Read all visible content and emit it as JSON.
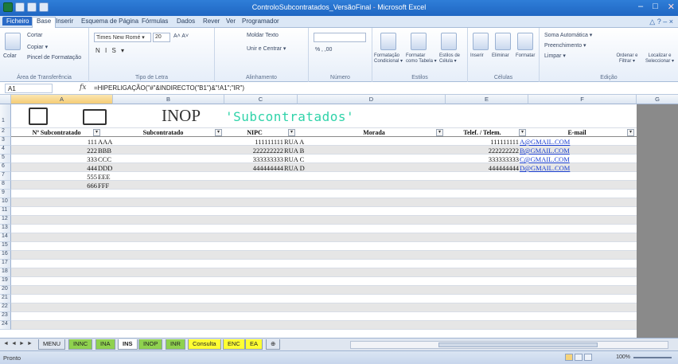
{
  "window": {
    "title_file": "ControloSubcontratados_VersãoFinal",
    "title_sep": " - ",
    "title_app": "Microsoft Excel",
    "min_glyph": "–",
    "max_glyph": "□",
    "close_glyph": "✕"
  },
  "menu": {
    "tabs": [
      "Ficheiro",
      "Base",
      "Inserir",
      "Esquema de Página",
      "Fórmulas",
      "Dados",
      "Rever",
      "Ver",
      "Programador"
    ],
    "help_glyph": "△ ? – ×"
  },
  "ribbon": {
    "clipboard": {
      "cut": "Cortar",
      "copy": "Copiar ▾",
      "paste": "Colar",
      "painter": "Pincel de Formatação",
      "label": "Área de Transferência"
    },
    "font": {
      "name": "Times New Romé ▾",
      "size": "20",
      "grow": "A˄ A˅",
      "bold_italic": "N  I  S ▾",
      "label": "Tipo de Letra"
    },
    "alignment": {
      "wrap": "Moldar Texto",
      "merge": "Unir e Centrar ▾",
      "label": "Alinhamento"
    },
    "number": {
      "format": "",
      "percent": "% ‚ ,00",
      "label": "Número"
    },
    "styles": {
      "cond": "Formatação Condicional ▾",
      "table": "Formatar como Tabela ▾",
      "cell": "Estilos de Célula ▾",
      "label": "Estilos"
    },
    "cells": {
      "insert": "Inserir",
      "delete": "Eliminar",
      "format": "Formatar",
      "label": "Células"
    },
    "editing": {
      "autosum": "Soma Automática ▾",
      "fill": "Preenchimento ▾",
      "clear": "Limpar ▾",
      "sort": "Ordenar e Filtrar ▾",
      "find": "Localizar e Seleccionar ▾",
      "label": "Edição"
    }
  },
  "formula_bar": {
    "name_box": "A1",
    "fx": "fx",
    "formula": "=HIPERLIGAÇÃO(\"#\"&INDIRECTO(\"B1\")&\"!A1\";\"IR\")"
  },
  "columns": [
    "A",
    "B",
    "C",
    "D",
    "E",
    "F",
    "G"
  ],
  "row_numbers": [
    "1",
    "2",
    "3",
    "4",
    "5",
    "6",
    "7",
    "8",
    "9",
    "10",
    "11",
    "12",
    "13",
    "14",
    "15",
    "16",
    "17",
    "18",
    "19",
    "20",
    "21",
    "22",
    "23",
    "24"
  ],
  "banner": {
    "inop": "INOP",
    "subtitle": "'Subcontratados'"
  },
  "table": {
    "headers": [
      "Nº Subcontratado",
      "Subcontratado",
      "NIPC",
      "Morada",
      "Telef. / Telem.",
      "E-mail"
    ],
    "rows": [
      {
        "num": "111",
        "name": "AAA",
        "nipc": "111111111",
        "morada": "RUA A",
        "tel": "111111111",
        "email": "A@GMAIL.COM"
      },
      {
        "num": "222",
        "name": "BBB",
        "nipc": "222222222",
        "morada": "RUA B",
        "tel": "222222222",
        "email": "B@GMAIL.COM"
      },
      {
        "num": "333",
        "name": "CCC",
        "nipc": "333333333",
        "morada": "RUA C",
        "tel": "333333333",
        "email": "C@GMAIL.COM"
      },
      {
        "num": "444",
        "name": "DDD",
        "nipc": "444444444",
        "morada": "RUA D",
        "tel": "444444444",
        "email": "D@GMAIL.COM"
      },
      {
        "num": "555",
        "name": "EEE",
        "nipc": "",
        "morada": "",
        "tel": "",
        "email": ""
      },
      {
        "num": "666",
        "name": "FFF",
        "nipc": "",
        "morada": "",
        "tel": "",
        "email": ""
      }
    ]
  },
  "sheet_tabs": [
    {
      "label": "MENU",
      "color": ""
    },
    {
      "label": "INNC",
      "color": "#8fd14f"
    },
    {
      "label": "INA",
      "color": "#8fd14f"
    },
    {
      "label": "INS",
      "color": "",
      "active": true
    },
    {
      "label": "INOP",
      "color": "#8fd14f"
    },
    {
      "label": "INR",
      "color": "#8fd14f"
    },
    {
      "label": "Consulta",
      "color": "#ffff33"
    },
    {
      "label": "ENC",
      "color": "#ffff33"
    },
    {
      "label": "EA",
      "color": "#ffff33"
    }
  ],
  "status": {
    "ready": "Pronto",
    "zoom": "100%"
  }
}
